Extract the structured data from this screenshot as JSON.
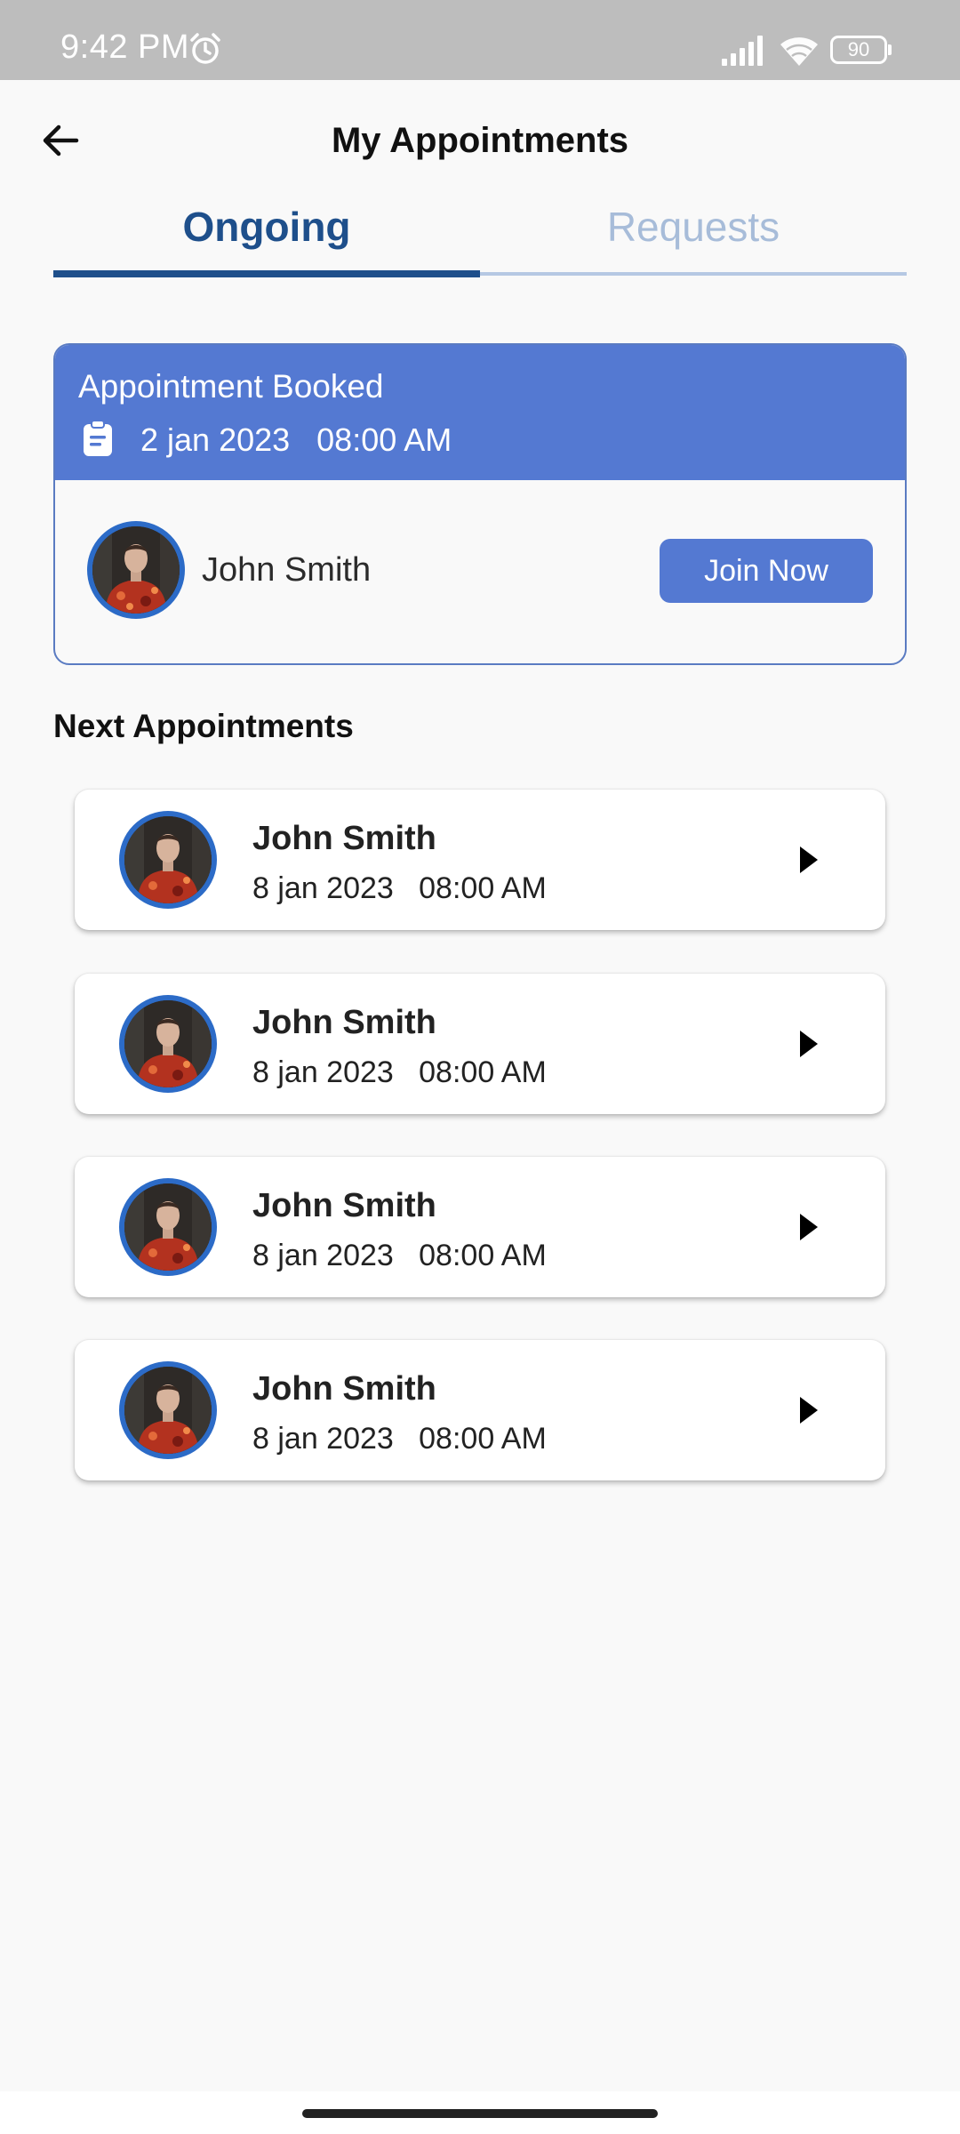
{
  "status_bar": {
    "time": "9:42 PM",
    "battery": "90",
    "icons": [
      "alarm-icon",
      "signal-icon",
      "wifi-icon",
      "battery-icon"
    ]
  },
  "header": {
    "title": "My Appointments",
    "back_icon": "arrow-left-icon"
  },
  "tabs": [
    {
      "label": "Ongoing",
      "active": true
    },
    {
      "label": "Requests",
      "active": false
    }
  ],
  "booked": {
    "title": "Appointment Booked",
    "date": "2 jan 2023   08:00 AM",
    "name": "John Smith",
    "join_label": "Join Now",
    "icon": "clipboard-icon"
  },
  "next": {
    "title": "Next Appointments",
    "items": [
      {
        "name": "John Smith",
        "date": "8 jan 2023   08:00 AM"
      },
      {
        "name": "John Smith",
        "date": "8 jan 2023   08:00 AM"
      },
      {
        "name": "John Smith",
        "date": "8 jan 2023   08:00 AM"
      },
      {
        "name": "John Smith",
        "date": "8 jan 2023   08:00 AM"
      }
    ]
  },
  "colors": {
    "primary": "#1e4f8b",
    "accent": "#5479d2",
    "tab_inactive": "#a7bcd9",
    "avatar_ring": "#2c6bc7"
  }
}
